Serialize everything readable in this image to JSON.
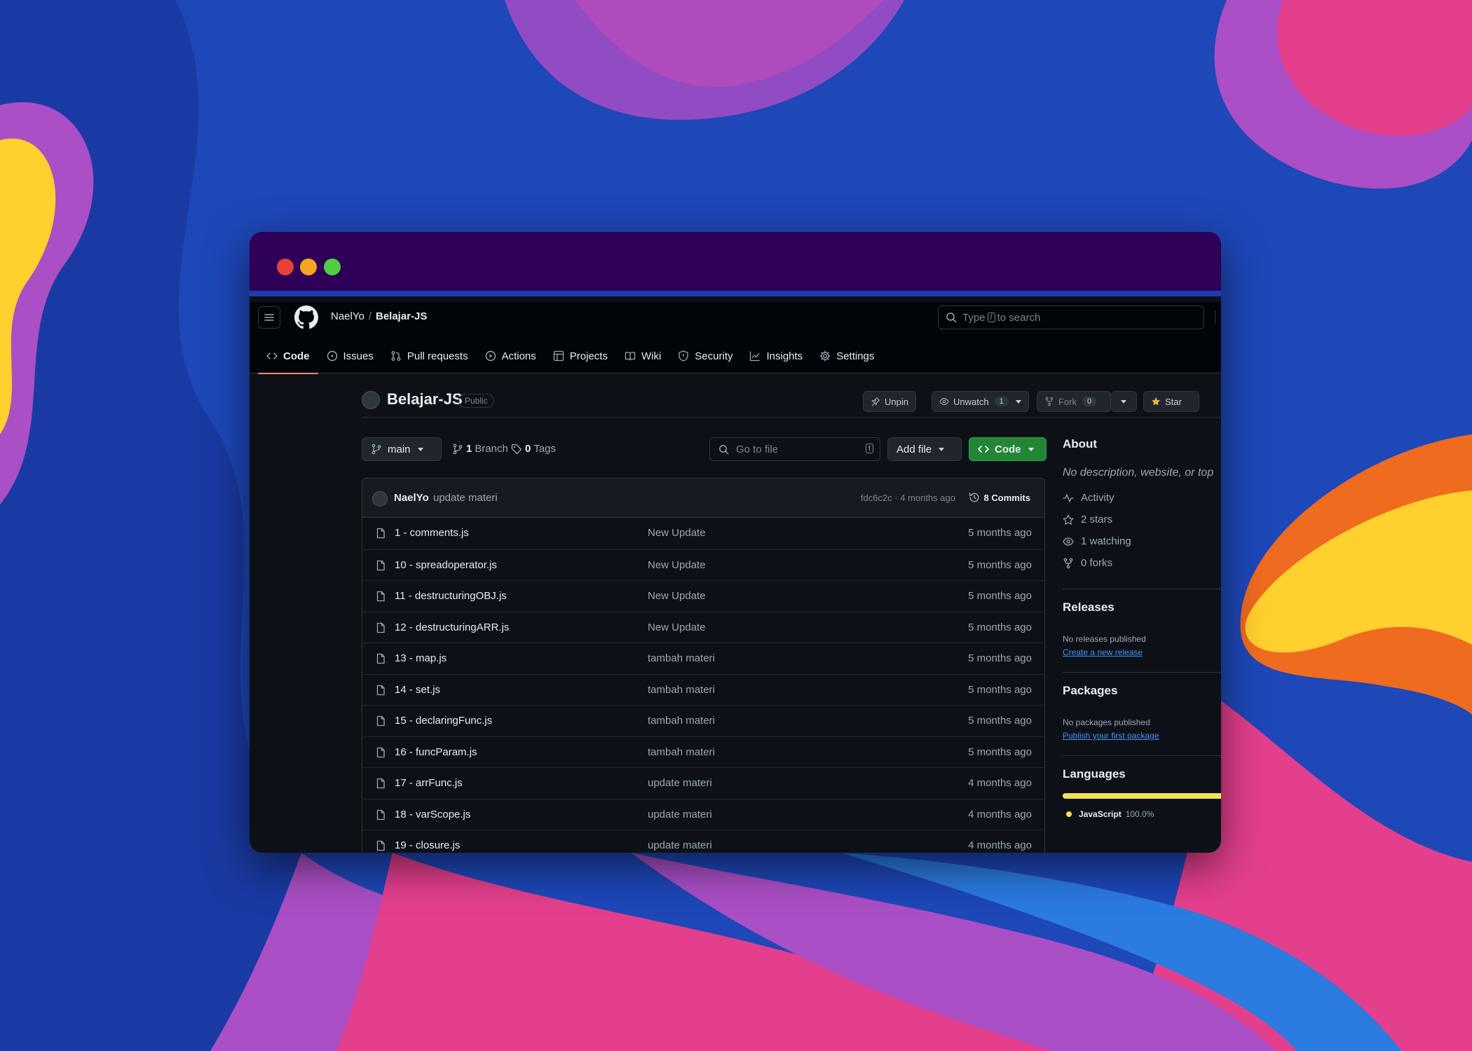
{
  "colors": {
    "accent_tab": "#fd8c73",
    "code_button": "#238636",
    "link": "#4493f8",
    "javascript": "#f1e05a",
    "titlebar": "#2e0057"
  },
  "header": {
    "owner": "NaelYo",
    "separator": "/",
    "repo": "Belajar-JS",
    "search": {
      "pre": "Type",
      "key": "/",
      "post": "to search"
    }
  },
  "tabs": [
    {
      "label": "Code",
      "icon": "code-icon"
    },
    {
      "label": "Issues",
      "icon": "issue-icon"
    },
    {
      "label": "Pull requests",
      "icon": "pull-request-icon"
    },
    {
      "label": "Actions",
      "icon": "play-icon"
    },
    {
      "label": "Projects",
      "icon": "table-icon"
    },
    {
      "label": "Wiki",
      "icon": "book-icon"
    },
    {
      "label": "Security",
      "icon": "shield-icon"
    },
    {
      "label": "Insights",
      "icon": "graph-icon"
    },
    {
      "label": "Settings",
      "icon": "gear-icon"
    }
  ],
  "repo": {
    "name": "Belajar-JS",
    "visibility": "Public",
    "unpin": "Unpin",
    "unwatch": "Unwatch",
    "watch_count": "1",
    "fork": "Fork",
    "fork_count": "0",
    "star": "Star"
  },
  "filebar": {
    "branch": "main",
    "branches_count": "1",
    "branches_label": "Branch",
    "tags_count": "0",
    "tags_label": "Tags",
    "goto_placeholder": "Go to file",
    "goto_key": "t",
    "add_file": "Add file",
    "code": "Code"
  },
  "latest_commit": {
    "author": "NaelYo",
    "message": "update materi",
    "meta": "fdc6c2c · 4 months ago",
    "commits_label": "8 Commits"
  },
  "files": [
    {
      "name": "1 - comments.js",
      "message": "New Update",
      "date": "5 months ago"
    },
    {
      "name": "10 - spreadoperator.js",
      "message": "New Update",
      "date": "5 months ago"
    },
    {
      "name": "11 - destructuringOBJ.js",
      "message": "New Update",
      "date": "5 months ago"
    },
    {
      "name": "12 - destructuringARR.js",
      "message": "New Update",
      "date": "5 months ago"
    },
    {
      "name": "13 - map.js",
      "message": "tambah materi",
      "date": "5 months ago"
    },
    {
      "name": "14 - set.js",
      "message": "tambah materi",
      "date": "5 months ago"
    },
    {
      "name": "15 - declaringFunc.js",
      "message": "tambah materi",
      "date": "5 months ago"
    },
    {
      "name": "16 - funcParam.js",
      "message": "tambah materi",
      "date": "5 months ago"
    },
    {
      "name": "17 - arrFunc.js",
      "message": "update materi",
      "date": "4 months ago"
    },
    {
      "name": "18 - varScope.js",
      "message": "update materi",
      "date": "4 months ago"
    },
    {
      "name": "19 - closure.js",
      "message": "update materi",
      "date": "4 months ago"
    }
  ],
  "about": {
    "title": "About",
    "description": "No description, website, or top",
    "activity": "Activity",
    "stars": "2 stars",
    "watching": "1 watching",
    "forks": "0 forks"
  },
  "releases": {
    "title": "Releases",
    "none": "No releases published",
    "link": "Create a new release"
  },
  "packages": {
    "title": "Packages",
    "none": "No packages published",
    "link": "Publish your first package"
  },
  "languages": {
    "title": "Languages",
    "items": [
      {
        "name": "JavaScript",
        "percent": "100.0%",
        "fraction": 1.0
      }
    ]
  }
}
